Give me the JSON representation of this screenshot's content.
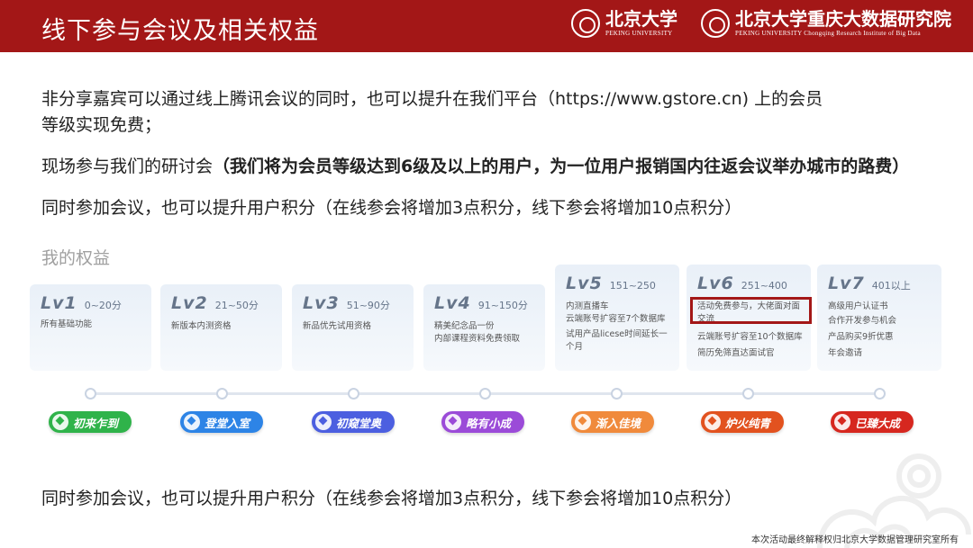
{
  "header": {
    "title": "线下参与会议及相关权益",
    "logo_pku": {
      "cn": "北京大学",
      "en": "PEKING UNIVERSITY"
    },
    "logo_bdr": {
      "cn": "北京大学重庆大数据研究院",
      "en": "PEKING UNIVERSITY Chongqing Research Institute of Big Data"
    }
  },
  "body": {
    "para1_line1": "非分享嘉宾可以通过线上腾讯会议的同时，也可以提升在我们平台（https://www.gstore.cn) 上的会员",
    "para1_line2": "等级实现免费；",
    "para2_prefix": "现场参与我们的研讨会",
    "para2_bold": "（我们将为会员等级达到6级及以上的用户，为一位用户报销国内往返会议举办城市的路费）",
    "para3": "同时参加会议，也可以提升用户积分（在线参会将增加3点积分，线下参会将增加10点积分）",
    "para4": "同时参加会议，也可以提升用户积分（在线参会将增加3点积分，线下参会将增加10点积分）"
  },
  "benefits": {
    "section_label": "我的权益",
    "levels": [
      {
        "lv": "Lv1",
        "range": "0~20分",
        "lines": [
          "所有基础功能"
        ],
        "badge": "初来乍到",
        "badge_color": "#2fb34a"
      },
      {
        "lv": "Lv2",
        "range": "21~50分",
        "lines": [
          "新版本内测资格"
        ],
        "badge": "登堂入室",
        "badge_color": "#2d84e6"
      },
      {
        "lv": "Lv3",
        "range": "51~90分",
        "lines": [
          "新品优先试用资格"
        ],
        "badge": "初窥堂奥",
        "badge_color": "#4c5fe0"
      },
      {
        "lv": "Lv4",
        "range": "91~150分",
        "lines": [
          "精美纪念品一份",
          "内部课程资料免费领取"
        ],
        "badge": "略有小成",
        "badge_color": "#9b4bd8"
      },
      {
        "lv": "Lv5",
        "range": "151~250",
        "lines": [
          "内测直播车",
          "云端账号扩容至7个数据库",
          "试用产品licese时间延长一",
          "个月"
        ],
        "badge": "渐入佳境",
        "badge_color": "#f08a3c"
      },
      {
        "lv": "Lv6",
        "range": "251~400",
        "lines": [
          "活动免费参与，大佬面对面",
          "交流",
          "云端账号扩容至10个数据库",
          "简历免筛直达面试官"
        ],
        "badge": "炉火纯青",
        "badge_color": "#e2521f"
      },
      {
        "lv": "Lv7",
        "range": "401以上",
        "lines": [
          "高级用户认证书",
          "合作开发参与机会",
          "产品购买9折优惠",
          "年会邀请"
        ],
        "badge": "已臻大成",
        "badge_color": "#d6271f"
      }
    ]
  },
  "footer": {
    "note": "本次活动最终解释权归北京大学数据管理研究室所有"
  },
  "colors": {
    "header_bg": "#a31717",
    "highlight_border": "#a31717"
  }
}
